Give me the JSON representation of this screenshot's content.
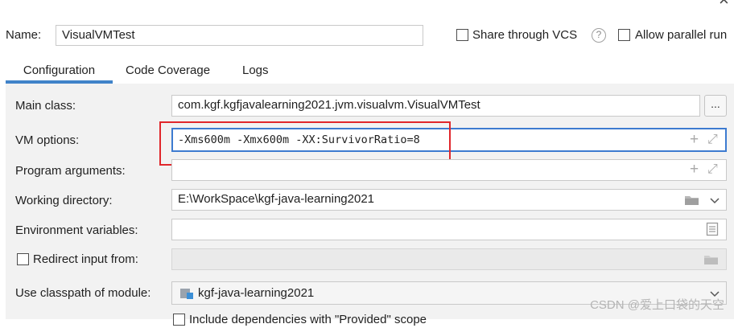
{
  "header": {
    "name_label": "Name:",
    "name_value": "VisualVMTest",
    "share_vcs_label": "Share through VCS",
    "help_icon_glyph": "?",
    "allow_parallel_label": "Allow parallel run",
    "close_icon_glyph": "×"
  },
  "tabs": [
    {
      "label": "Configuration",
      "active": true
    },
    {
      "label": "Code Coverage",
      "active": false
    },
    {
      "label": "Logs",
      "active": false
    }
  ],
  "form": {
    "main_class_label": "Main class:",
    "main_class_value": "com.kgf.kgfjavalearning2021.jvm.visualvm.VisualVMTest",
    "browse_button": "...",
    "vm_options_label": "VM options:",
    "vm_options_value": "-Xms600m -Xmx600m -XX:SurvivorRatio=8",
    "program_args_label": "Program arguments:",
    "program_args_value": "",
    "working_dir_label": "Working directory:",
    "working_dir_value": "E:\\WorkSpace\\kgf-java-learning2021",
    "env_vars_label": "Environment variables:",
    "env_vars_value": "",
    "redirect_label": "Redirect input from:",
    "classpath_label": "Use classpath of module:",
    "classpath_value": "kgf-java-learning2021",
    "include_deps_label": "Include dependencies with \"Provided\" scope"
  },
  "icons": {
    "plus": "+",
    "expand": "⤢",
    "folder": "folder-icon",
    "chevron": "⌄",
    "document": "document-icon",
    "module": "module-icon"
  },
  "colors": {
    "accent_tab": "#4083c9",
    "focus_border": "#3d7bd0",
    "annotation_red": "#e0262b",
    "panel_bg": "#f2f2f2"
  },
  "watermark": "CSDN @爱上口袋的天空"
}
